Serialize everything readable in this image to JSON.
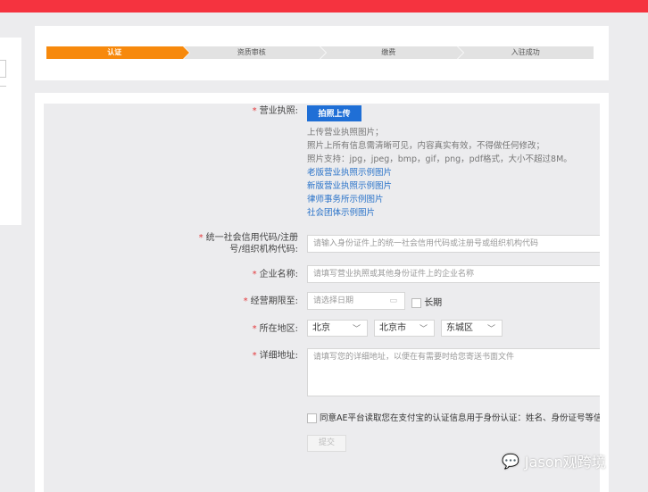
{
  "steps": [
    "认证",
    "资质审核",
    "缴费",
    "入驻成功"
  ],
  "form": {
    "license": {
      "label": "营业执照:",
      "button": "拍照上传",
      "help": [
        "上传营业执照图片；",
        "照片上所有信息需清晰可见，内容真实有效，不得做任何修改；",
        "照片支持：jpg，jpeg，bmp，gif，png，pdf格式，大小不超过8M。"
      ],
      "links": [
        "老版营业执照示例图片",
        "新版营业执照示例图片",
        "律师事务所示例图片",
        "社会团体示例图片"
      ]
    },
    "credit_code": {
      "label_line1": "统一社会信用代码/注册",
      "label_line2": "号/组织机构代码:",
      "placeholder": "请输入身份证件上的统一社会信用代码或注册号或组织机构代码"
    },
    "company_name": {
      "label": "企业名称:",
      "placeholder": "请填写营业执照或其他身份证件上的企业名称"
    },
    "term": {
      "label": "经营期限至:",
      "placeholder": "请选择日期",
      "long_term": "长期"
    },
    "region": {
      "label": "所在地区:",
      "province": "北京",
      "city": "北京市",
      "district": "东城区"
    },
    "address": {
      "label": "详细地址:",
      "placeholder": "请填写您的详细地址，以便在有需要时给您寄送书面文件"
    },
    "agree": "同意AE平台读取您在支付宝的认证信息用于身份认证：姓名、身份证号等信息",
    "submit": "提交",
    "required_mark": "*"
  },
  "watermark": "Jason观跨境",
  "colors": {
    "topbar": "#f5333f",
    "active_step": "#f7890c",
    "primary": "#1f6fd6",
    "link": "#2a73c9"
  }
}
